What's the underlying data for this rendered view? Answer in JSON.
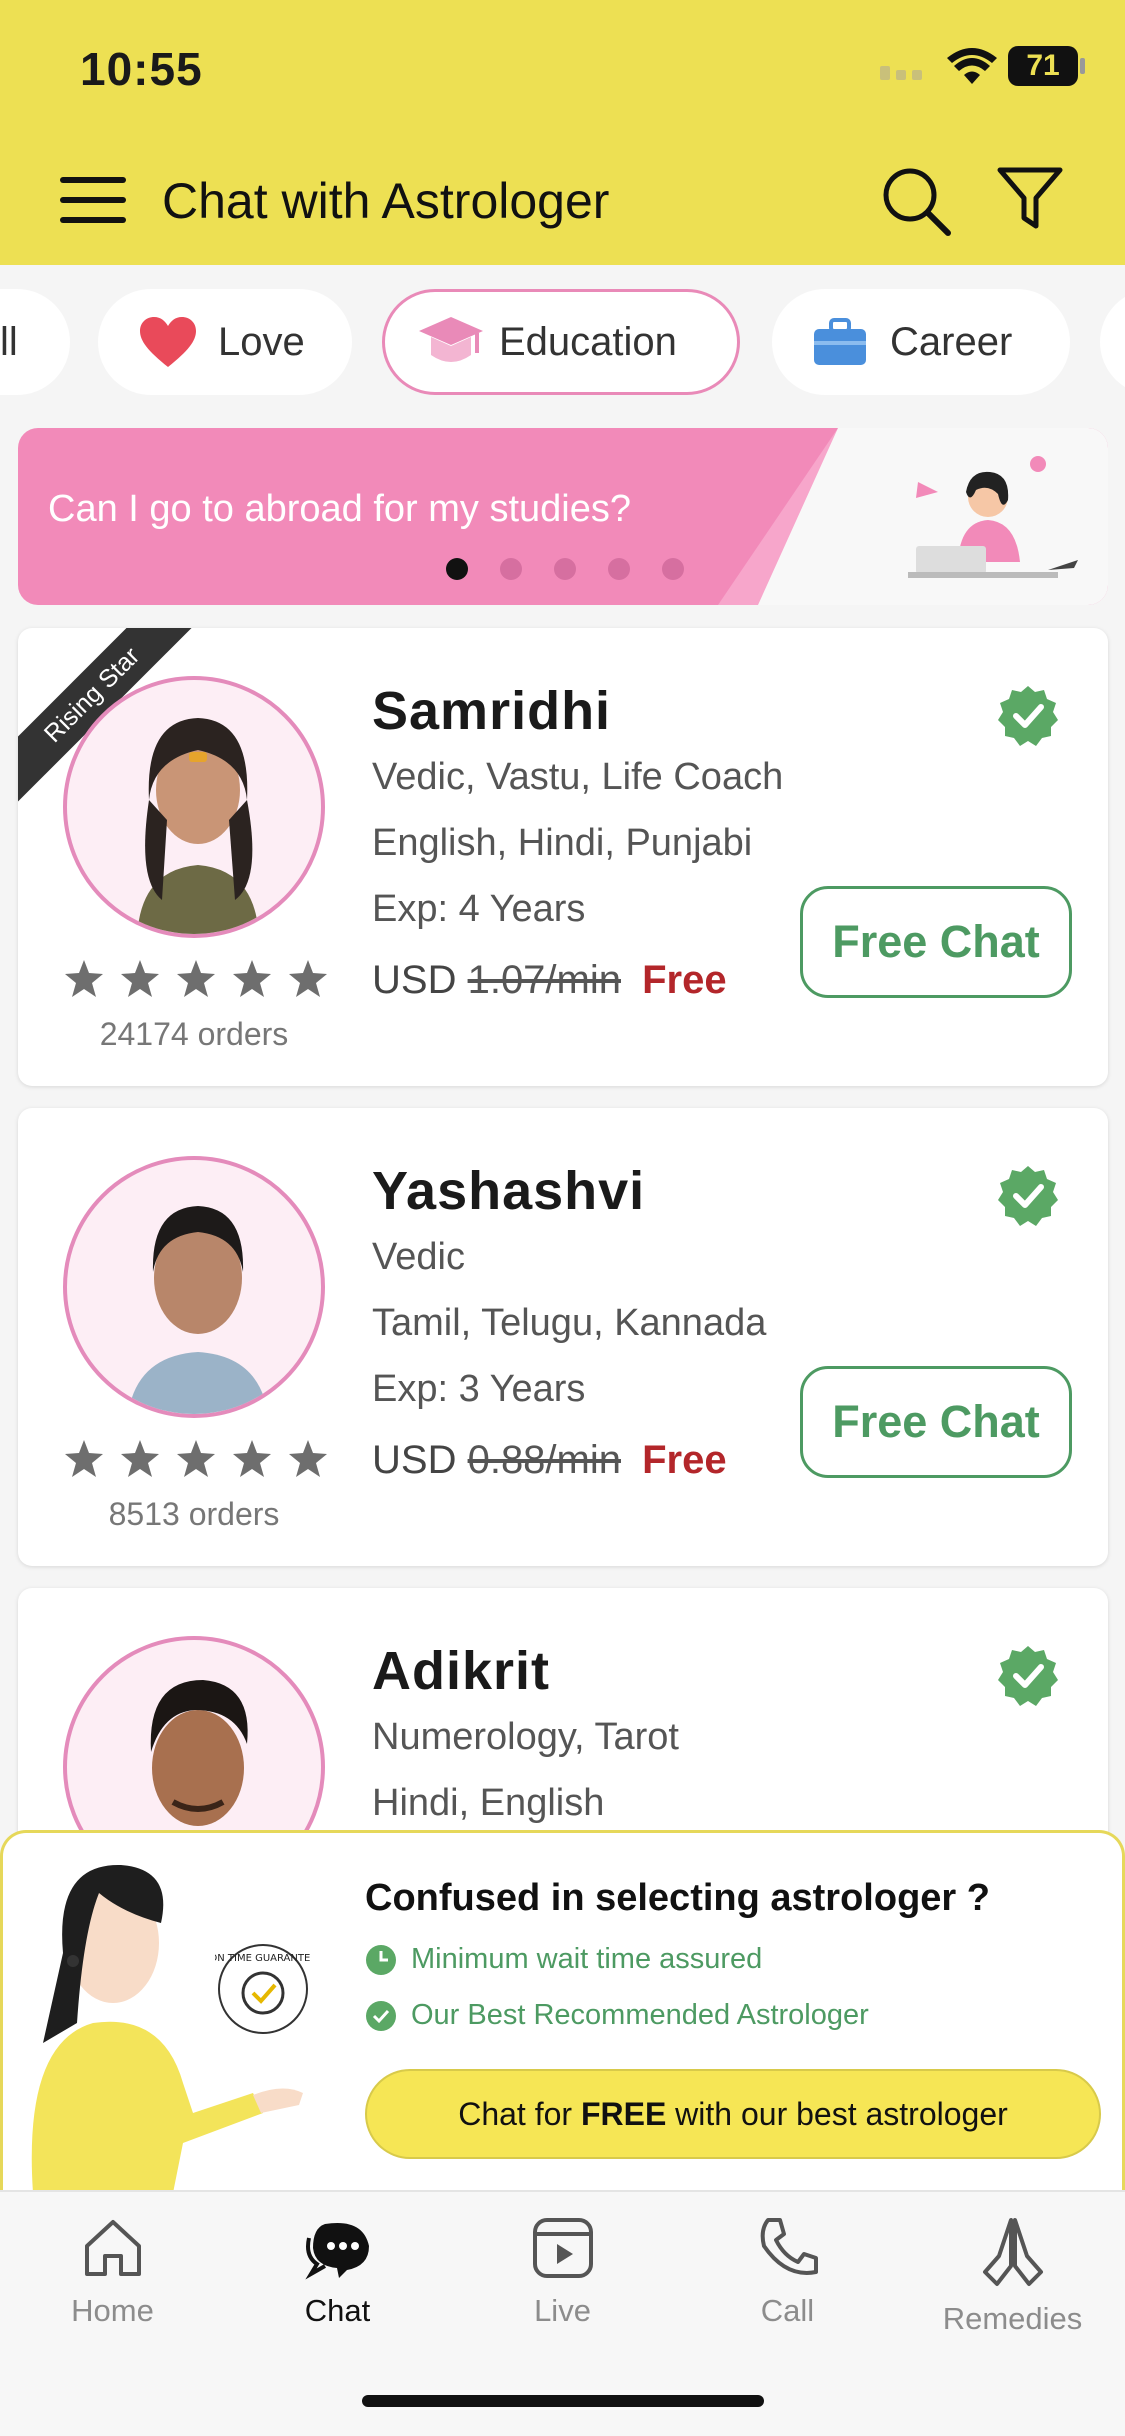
{
  "status_bar": {
    "time": "10:55",
    "battery": "71"
  },
  "app_bar": {
    "title": "Chat with Astrologer"
  },
  "categories": [
    {
      "label": "ll",
      "icon": "list-icon"
    },
    {
      "label": "Love",
      "icon": "heart-icon"
    },
    {
      "label": "Education",
      "icon": "graduation-cap-icon",
      "active": true
    },
    {
      "label": "Career",
      "icon": "briefcase-icon"
    }
  ],
  "banner": {
    "text": "Can I go to abroad for my studies?",
    "active_dot": 1,
    "dot_count": 5
  },
  "astrologers": [
    {
      "name": "Samridhi",
      "skills": "Vedic,  Vastu,  Life Coach",
      "languages": "English, Hindi, Punjabi",
      "experience": "Exp: 4 Years",
      "currency": "USD",
      "old_price": "1.07/min",
      "price_label": "Free",
      "rating": 5,
      "orders": "24174 orders",
      "button": "Free Chat",
      "ribbon": "Rising Star"
    },
    {
      "name": "Yashashvi",
      "skills": "Vedic",
      "languages": "Tamil, Telugu, Kannada",
      "experience": "Exp: 3 Years",
      "currency": "USD",
      "old_price": "0.88/min",
      "price_label": "Free",
      "rating": 5,
      "orders": "8513 orders",
      "button": "Free Chat"
    },
    {
      "name": "Adikrit",
      "skills": "Numerology,  Tarot",
      "languages": "Hindi, English"
    }
  ],
  "promo": {
    "title": "Confused in selecting astrologer ?",
    "items": [
      "Minimum wait time assured",
      "Our Best Recommended Astrologer"
    ],
    "badge": "ON TIME GUARANTEE",
    "button_pre": "Chat for ",
    "button_bold": "FREE",
    "button_post": " with our best astrologer"
  },
  "tabs": [
    {
      "label": "Home",
      "icon": "home-icon"
    },
    {
      "label": "Chat",
      "icon": "chat-icon",
      "active": true
    },
    {
      "label": "Live",
      "icon": "live-icon"
    },
    {
      "label": "Call",
      "icon": "phone-icon"
    },
    {
      "label": "Remedies",
      "icon": "praying-hands-icon"
    }
  ],
  "colors": {
    "brand_yellow": "#ede053",
    "accent_pink": "#e98ab8",
    "free_red": "#b3262a",
    "chat_green": "#4d9a62"
  }
}
